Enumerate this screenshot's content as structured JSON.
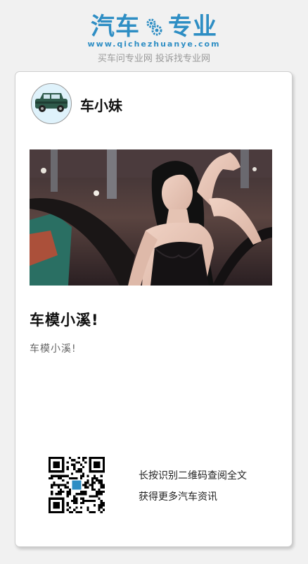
{
  "brand": {
    "logo_part1": "汽车",
    "logo_part2": "专业",
    "url": "www.qichezhuanye.com",
    "slogan": "买车问专业网 投诉找专业网",
    "color": "#2e8ec4"
  },
  "post": {
    "author_name": "车小妹",
    "avatar_icon": "car-icon",
    "title": "车模小溪!",
    "summary": "车模小溪!"
  },
  "footer": {
    "qr_icon": "qr-code-icon",
    "cta_line1": "长按识别二维码查阅全文",
    "cta_line2": "获得更多汽车资讯"
  }
}
